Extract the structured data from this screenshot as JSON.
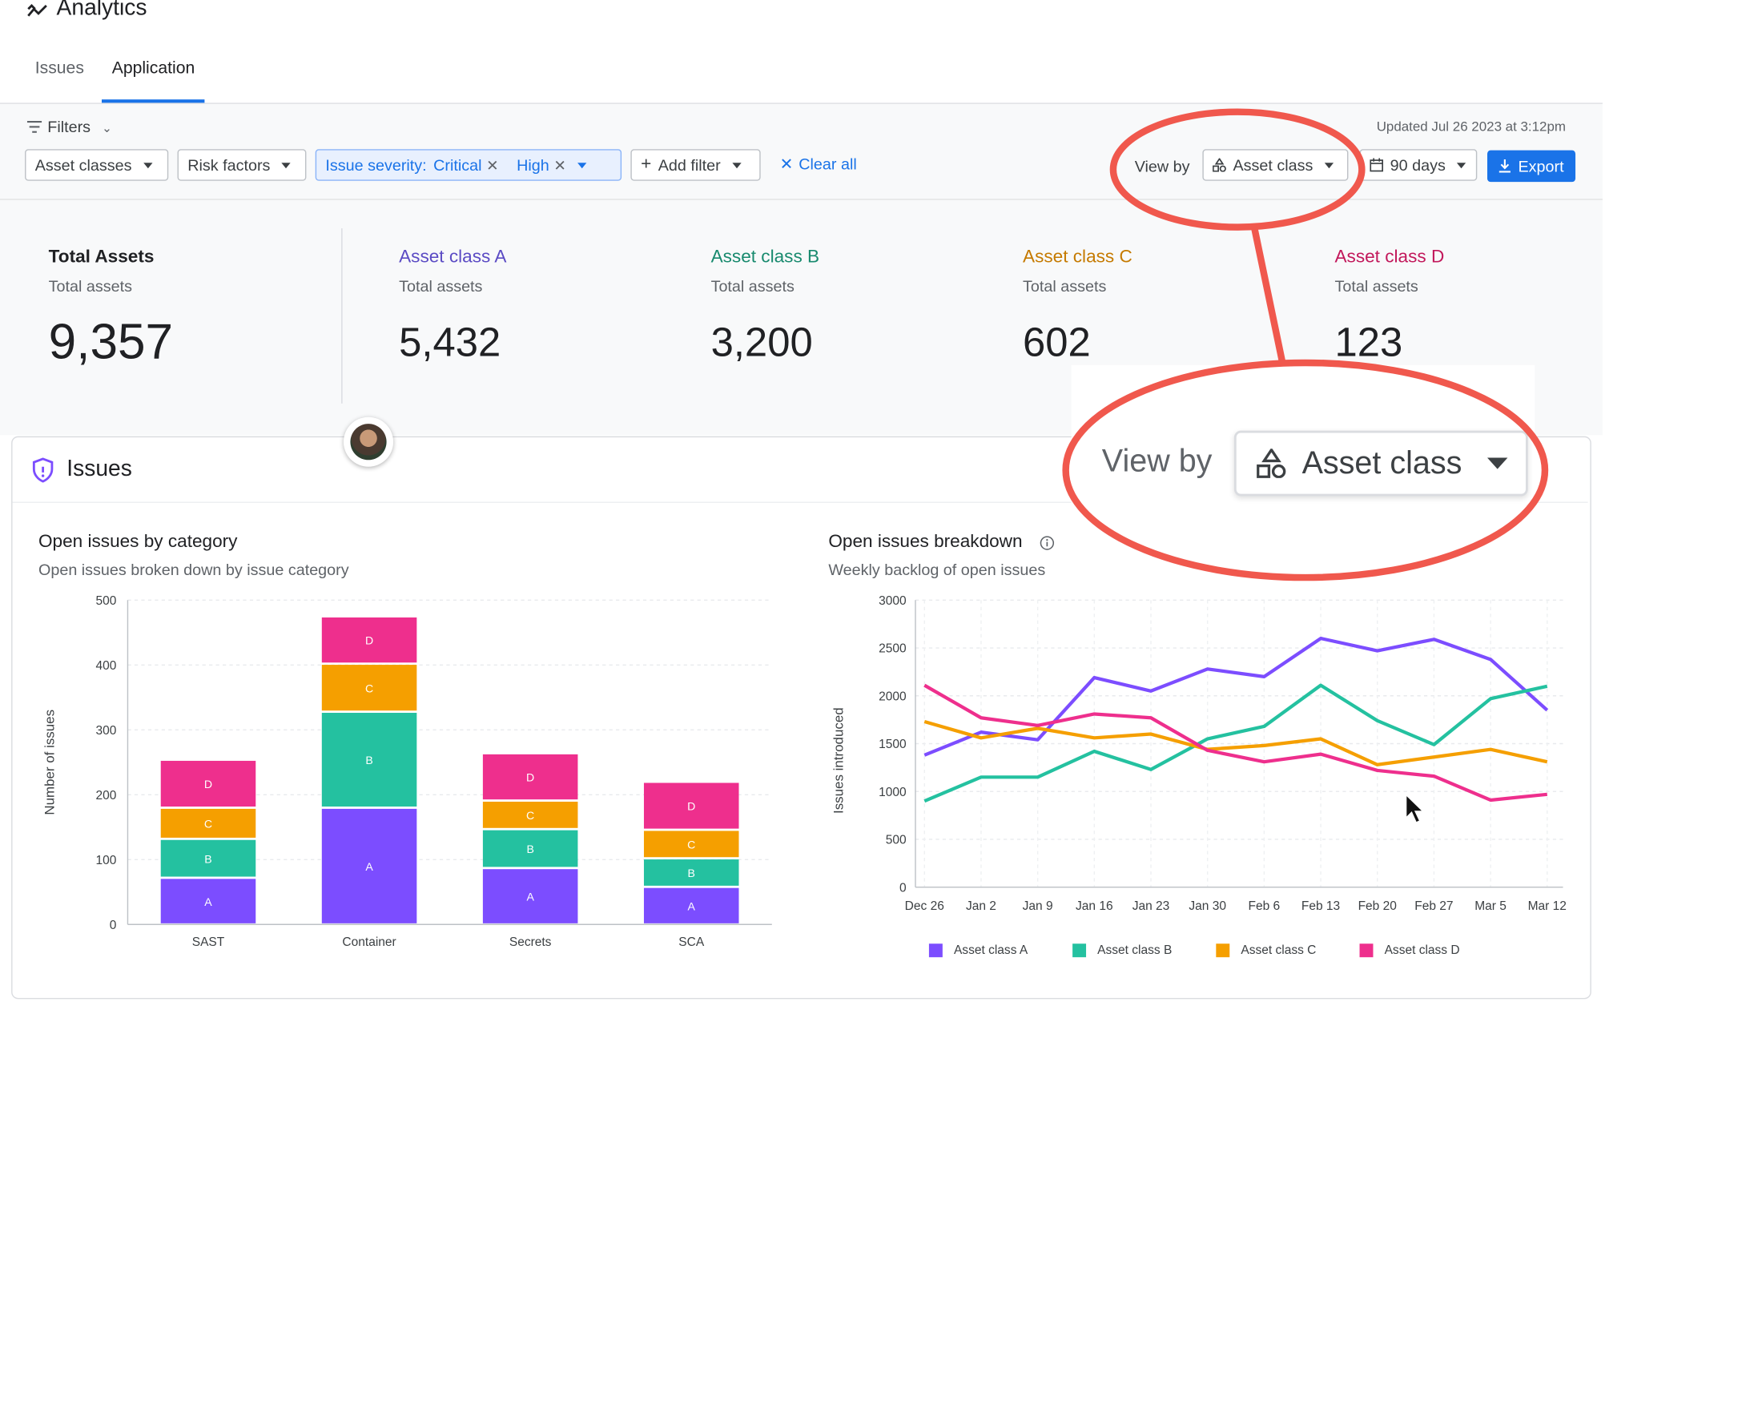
{
  "app": {
    "title": "Analytics"
  },
  "tabs": [
    "Issues",
    "Application"
  ],
  "filters": {
    "label": "Filters",
    "asset_classes": "Asset classes",
    "risk_factors": "Risk factors",
    "severity_label": "Issue severity:",
    "severity_values": [
      "Critical",
      "High"
    ],
    "add_filter": "Add filter",
    "clear_all": "Clear all",
    "updated": "Updated Jul 26 2023 at 3:12pm",
    "view_by_label": "View by",
    "view_by_value": "Asset class",
    "range": "90 days",
    "export": "Export"
  },
  "stats": [
    {
      "name": "Total Assets",
      "sub": "Total assets",
      "value": "9,357",
      "color": "#202124"
    },
    {
      "name": "Asset class A",
      "sub": "Total assets",
      "value": "5,432",
      "color": "#5b4bc4"
    },
    {
      "name": "Asset class B",
      "sub": "Total assets",
      "value": "3,200",
      "color": "#188a6e"
    },
    {
      "name": "Asset class C",
      "sub": "Total assets",
      "value": "602",
      "color": "#c57a00"
    },
    {
      "name": "Asset class D",
      "sub": "Total assets",
      "value": "123",
      "color": "#c2185b"
    }
  ],
  "issues_card": {
    "title": "Issues"
  },
  "zoom_callout": {
    "label": "View by",
    "value": "Asset class",
    "color": "#f0584d"
  },
  "colors": {
    "A": "#7c4dff",
    "B": "#24c1a0",
    "C": "#f59f00",
    "D": "#ee2f8d",
    "accent": "#1a73e8"
  },
  "chart_data": [
    {
      "type": "bar",
      "stacked": true,
      "title": "Open issues by category",
      "subtitle": "Open issues broken down by issue category",
      "xlabel": "",
      "ylabel": "Number of issues",
      "ylim": [
        0,
        500
      ],
      "yticks": [
        0,
        100,
        200,
        300,
        400,
        500
      ],
      "categories": [
        "SAST",
        "Container",
        "Secrets",
        "SCA"
      ],
      "grid": true,
      "series": [
        {
          "name": "A",
          "values": [
            72,
            180,
            87,
            58
          ]
        },
        {
          "name": "B",
          "values": [
            60,
            148,
            60,
            44
          ]
        },
        {
          "name": "C",
          "values": [
            48,
            74,
            44,
            44
          ]
        },
        {
          "name": "D",
          "values": [
            74,
            73,
            73,
            74
          ]
        }
      ]
    },
    {
      "type": "line",
      "title": "Open issues breakdown",
      "subtitle": "Weekly backlog of open issues",
      "xlabel": "",
      "ylabel": "Issues introduced",
      "ylim": [
        0,
        3000
      ],
      "yticks": [
        0,
        500,
        1000,
        1500,
        2000,
        2500,
        3000
      ],
      "x": [
        "Dec 26",
        "Jan 2",
        "Jan 9",
        "Jan 16",
        "Jan 23",
        "Jan 30",
        "Feb 6",
        "Feb 13",
        "Feb 20",
        "Feb 27",
        "Mar 5",
        "Mar 12"
      ],
      "grid": true,
      "legend": "bottom",
      "series": [
        {
          "name": "Asset class A",
          "values": [
            1380,
            1620,
            1540,
            2190,
            2050,
            2280,
            2200,
            2600,
            2470,
            2590,
            2380,
            1850
          ]
        },
        {
          "name": "Asset class B",
          "values": [
            900,
            1150,
            1150,
            1420,
            1230,
            1550,
            1680,
            2110,
            1740,
            1490,
            1970,
            2100
          ]
        },
        {
          "name": "Asset class C",
          "values": [
            1730,
            1560,
            1660,
            1560,
            1600,
            1440,
            1480,
            1550,
            1280,
            1360,
            1440,
            1310
          ]
        },
        {
          "name": "Asset class D",
          "values": [
            2110,
            1770,
            1690,
            1810,
            1770,
            1430,
            1310,
            1390,
            1220,
            1160,
            910,
            970
          ]
        }
      ]
    }
  ]
}
